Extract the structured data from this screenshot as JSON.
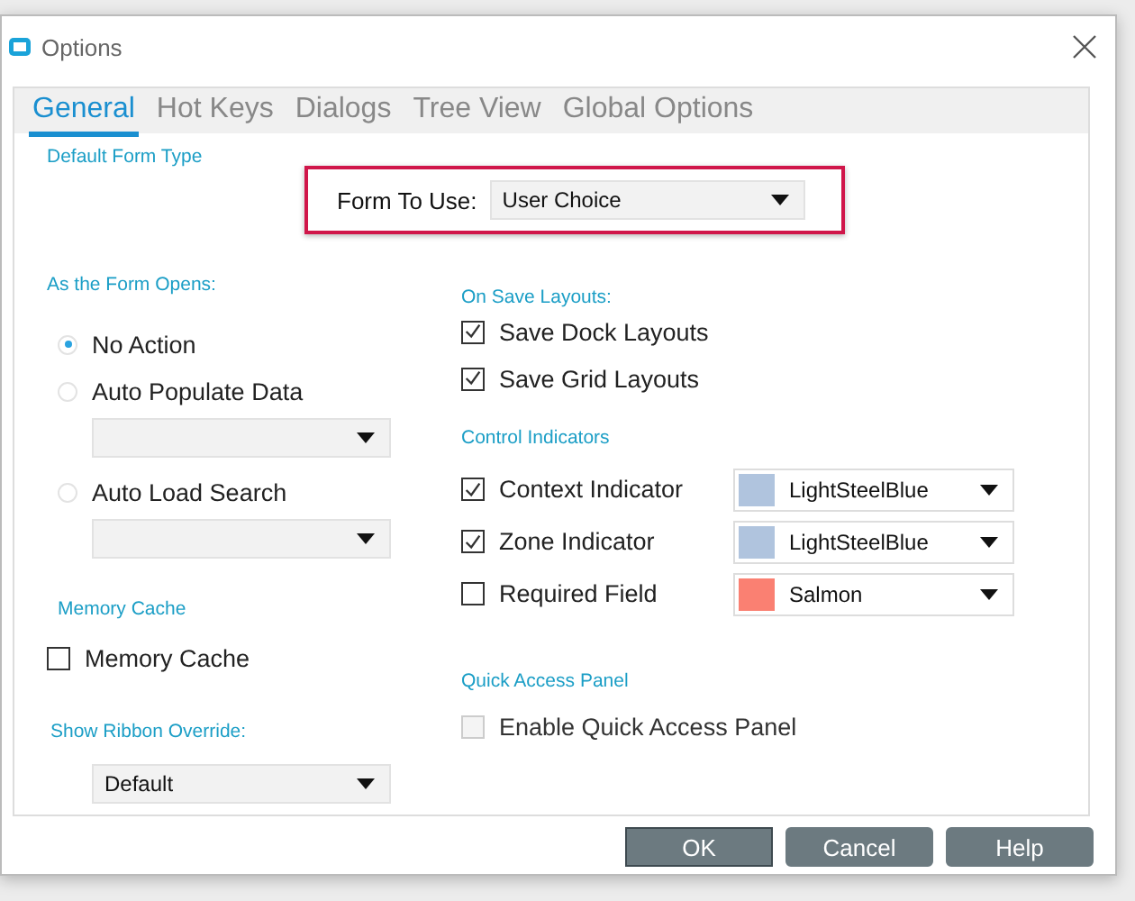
{
  "window": {
    "title": "Options"
  },
  "tabs": [
    {
      "label": "General",
      "selected": true
    },
    {
      "label": "Hot Keys",
      "selected": false
    },
    {
      "label": "Dialogs",
      "selected": false
    },
    {
      "label": "Tree View",
      "selected": false
    },
    {
      "label": "Global Options",
      "selected": false
    }
  ],
  "default_form_type": {
    "heading": "Default Form Type",
    "label": "Form To Use:",
    "value": "User Choice",
    "highlighted": true
  },
  "form_opens": {
    "heading": "As the Form Opens:",
    "options": [
      {
        "kind": "radio",
        "label": "No Action",
        "selected": true
      },
      {
        "kind": "radio",
        "label": "Auto Populate Data",
        "selected": false
      },
      {
        "kind": "dropdown"
      },
      {
        "kind": "radio",
        "label": "Auto Load Search",
        "selected": false
      },
      {
        "kind": "dropdown"
      }
    ]
  },
  "memory_cache": {
    "heading": "Memory Cache",
    "label": "Memory Cache",
    "checked": false
  },
  "ribbon_override": {
    "heading": "Show Ribbon Override:",
    "value": "Default"
  },
  "save_layouts": {
    "heading": "On Save Layouts:",
    "items": [
      {
        "label": "Save Dock Layouts",
        "checked": true
      },
      {
        "label": "Save Grid Layouts",
        "checked": true
      }
    ]
  },
  "control_indicators": {
    "heading": "Control Indicators",
    "items": [
      {
        "label": "Context Indicator",
        "checked": true,
        "color": "#b0c4de",
        "color_name": "LightSteelBlue"
      },
      {
        "label": "Zone Indicator",
        "checked": true,
        "color": "#b0c4de",
        "color_name": "LightSteelBlue"
      },
      {
        "label": "Required Field",
        "checked": false,
        "color": "#fa8072",
        "color_name": "Salmon"
      }
    ]
  },
  "quick_access": {
    "heading": "Quick Access Panel",
    "label": "Enable Quick Access Panel",
    "checked": false,
    "disabled": true
  },
  "buttons": [
    {
      "label": "OK",
      "default": true
    },
    {
      "label": "Cancel",
      "default": false
    },
    {
      "label": "Help",
      "default": false
    }
  ]
}
